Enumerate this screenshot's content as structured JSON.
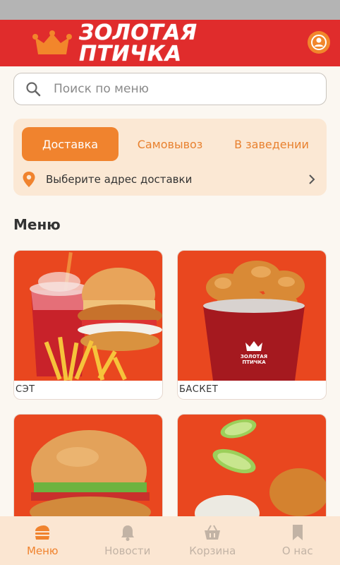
{
  "app": {
    "brand": "ЗОЛОТАЯ ПТИЧКА"
  },
  "search": {
    "placeholder": "Поиск по меню"
  },
  "delivery": {
    "tabs": [
      {
        "label": "Доставка",
        "active": true
      },
      {
        "label": "Самовывоз",
        "active": false
      },
      {
        "label": "В заведении",
        "active": false
      }
    ],
    "address_prompt": "Выберите адрес доставки"
  },
  "menu": {
    "heading": "Меню",
    "items": [
      {
        "label": "СЭТ"
      },
      {
        "label": "БАСКЕТ"
      },
      {
        "label": ""
      },
      {
        "label": ""
      }
    ],
    "bucket_print": "ЗОЛОТАЯ ПТИЧКА"
  },
  "nav": {
    "items": [
      {
        "label": "Меню",
        "icon": "burger-icon",
        "active": true
      },
      {
        "label": "Новости",
        "icon": "bell-icon",
        "active": false
      },
      {
        "label": "Корзина",
        "icon": "basket-icon",
        "active": false
      },
      {
        "label": "О нас",
        "icon": "bookmark-icon",
        "active": false
      }
    ]
  },
  "colors": {
    "brand_red": "#e02c2c",
    "accent_orange": "#f0832e",
    "card_bg": "#fbe8d4",
    "food_bg": "#e9471f"
  }
}
